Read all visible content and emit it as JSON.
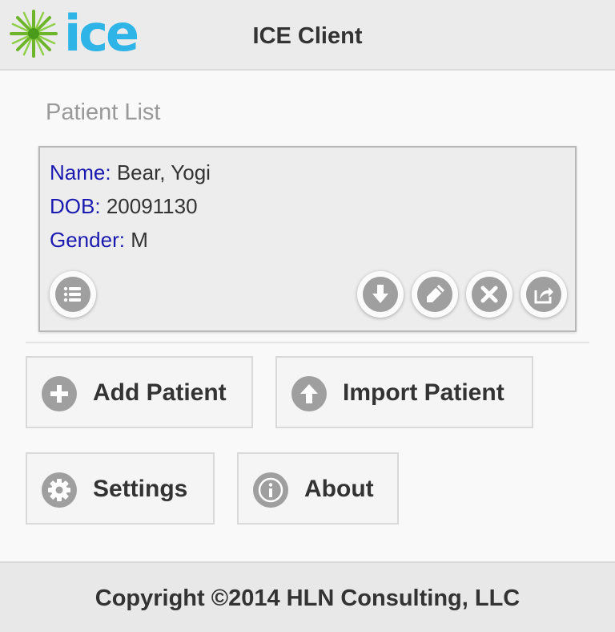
{
  "header": {
    "logo_text": "ice",
    "title": "ICE Client"
  },
  "patient_list": {
    "title": "Patient List",
    "patient": {
      "name_label": "Name:",
      "name": "Bear, Yogi",
      "dob_label": "DOB:",
      "dob": "20091130",
      "gender_label": "Gender:",
      "gender": "M"
    },
    "card_actions": [
      "list-icon",
      "download-icon",
      "edit-icon",
      "delete-icon",
      "share-icon"
    ]
  },
  "actions": {
    "add_patient": "Add Patient",
    "import_patient": "Import Patient",
    "settings": "Settings",
    "about": "About"
  },
  "footer": {
    "copyright": "Copyright ©2014 HLN Consulting, LLC"
  },
  "colors": {
    "label_blue": "#1a1ab0",
    "icon_gray": "#9f9f9f",
    "logo_blue": "#2eb4e6",
    "logo_green": "#6fb52c"
  }
}
